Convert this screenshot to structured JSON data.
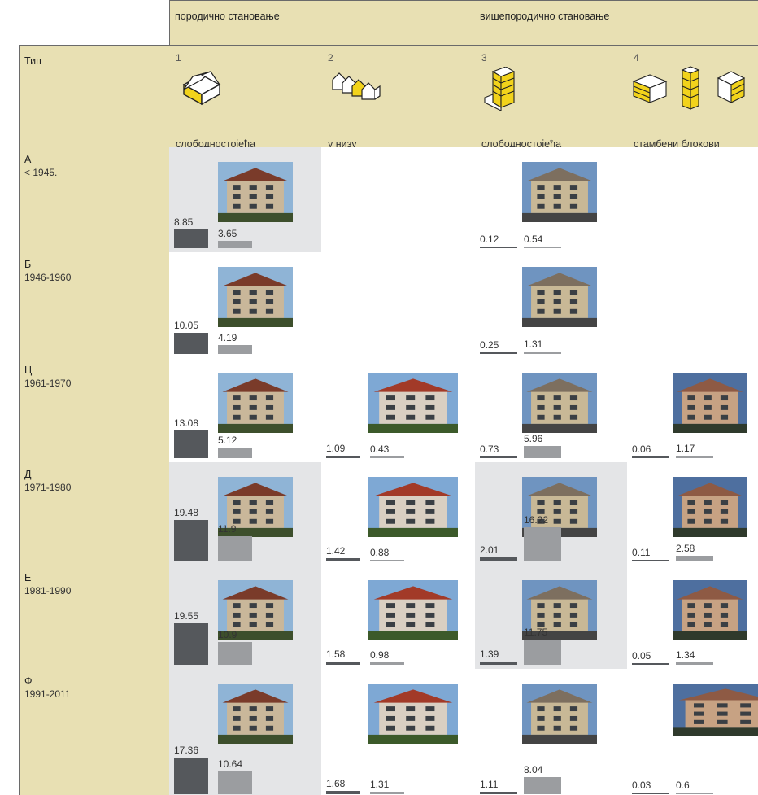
{
  "groups": {
    "family": "породично становање",
    "multi": "вишепородично становање"
  },
  "type_header": "Тип",
  "types": [
    {
      "num": "1",
      "name": "слободностојећа",
      "icon": "detached-house-icon"
    },
    {
      "num": "2",
      "name": "у низу",
      "icon": "row-houses-icon"
    },
    {
      "num": "3",
      "name": "слободностојећа",
      "icon": "apartment-tower-icon"
    },
    {
      "num": "4",
      "name": "стамбени блокови",
      "icon": "housing-blocks-icon"
    }
  ],
  "periods": [
    {
      "code": "А",
      "years": "< 1945."
    },
    {
      "code": "Б",
      "years": "1946-1960"
    },
    {
      "code": "Ц",
      "years": "1961-1970"
    },
    {
      "code": "Д",
      "years": "1971-1980"
    },
    {
      "code": "Е",
      "years": "1981-1990"
    },
    {
      "code": "Ф",
      "years": "1991-2011"
    }
  ],
  "cells": [
    [
      {
        "a": "8.85",
        "b": "3.65",
        "photo": "house-photo",
        "highlight": true
      },
      null,
      {
        "a": "0.12",
        "b": "0.54",
        "photo": "building-photo",
        "highlight": false
      },
      null
    ],
    [
      {
        "a": "10.05",
        "b": "4.19",
        "photo": "house-photo",
        "highlight": false
      },
      null,
      {
        "a": "0.25",
        "b": "1.31",
        "photo": "building-photo",
        "highlight": false
      },
      null
    ],
    [
      {
        "a": "13.08",
        "b": "5.12",
        "photo": "house-photo",
        "highlight": false
      },
      {
        "a": "1.09",
        "b": "0.43",
        "photo": "row-house-photo",
        "highlight": false
      },
      {
        "a": "0.73",
        "b": "5.96",
        "photo": "building-photo",
        "highlight": false
      },
      {
        "a": "0.06",
        "b": "1.17",
        "photo": "block-photo",
        "highlight": false
      }
    ],
    [
      {
        "a": "19.48",
        "b": "11.9",
        "photo": "house-photo",
        "highlight": true
      },
      {
        "a": "1.42",
        "b": "0.88",
        "photo": "row-house-photo",
        "highlight": false
      },
      {
        "a": "2.01",
        "b": "16.22",
        "photo": "building-photo",
        "highlight": true
      },
      {
        "a": "0.11",
        "b": "2.58",
        "photo": "block-photo",
        "highlight": false
      }
    ],
    [
      {
        "a": "19.55",
        "b": "10.9",
        "photo": "house-photo",
        "highlight": true
      },
      {
        "a": "1.58",
        "b": "0.98",
        "photo": "row-house-photo",
        "highlight": false
      },
      {
        "a": "1.39",
        "b": "11.75",
        "photo": "building-photo",
        "highlight": true
      },
      {
        "a": "0.05",
        "b": "1.34",
        "photo": "block-photo",
        "highlight": false
      }
    ],
    [
      {
        "a": "17.36",
        "b": "10.64",
        "photo": "house-photo",
        "highlight": true
      },
      {
        "a": "1.68",
        "b": "1.31",
        "photo": "row-house-photo",
        "highlight": false
      },
      {
        "a": "1.11",
        "b": "8.04",
        "photo": "building-photo",
        "highlight": false
      },
      {
        "a": "0.03",
        "b": "0.6",
        "photo": "block-photo",
        "highlight": false
      }
    ]
  ],
  "colors": {
    "header_bg": "#e8e0b3",
    "highlight_bg": "#e4e5e7",
    "icon_yellow": "#f2d31b",
    "bar_dark": "#55585c",
    "bar_light": "#9b9da0"
  }
}
